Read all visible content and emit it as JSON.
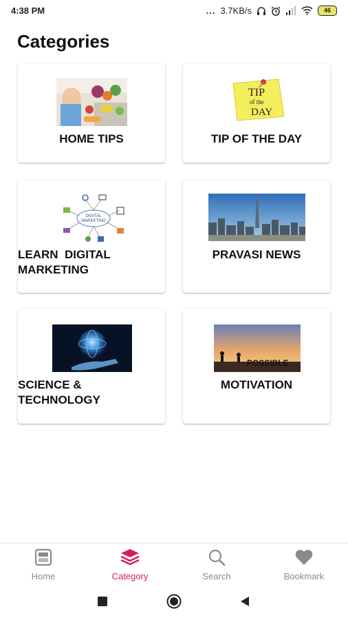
{
  "status_bar": {
    "time": "4:38 PM",
    "more": "...",
    "speed": "3.7KB/s",
    "battery": "46"
  },
  "page": {
    "title": "Categories"
  },
  "categories": [
    {
      "label": "HOME TIPS"
    },
    {
      "label": "TIP OF THE DAY"
    },
    {
      "label": "LEARN  DIGITAL MARKETING"
    },
    {
      "label": "PRAVASI NEWS"
    },
    {
      "label": "SCIENCE & TECHNOLOGY"
    },
    {
      "label": "MOTIVATION"
    }
  ],
  "images": {
    "tip_note": [
      "TIP",
      "of the",
      "DAY"
    ],
    "digital_center": [
      "DIGITAL",
      "MARKETING"
    ],
    "possible": "POSSIBLE"
  },
  "bottom_nav": [
    {
      "label": "Home",
      "icon": "home-icon"
    },
    {
      "label": "Category",
      "icon": "layers-icon",
      "active": true
    },
    {
      "label": "Search",
      "icon": "search-icon"
    },
    {
      "label": "Bookmark",
      "icon": "heart-icon"
    }
  ],
  "colors": {
    "accent": "#d81b60",
    "inactive": "#8a8a8a"
  }
}
